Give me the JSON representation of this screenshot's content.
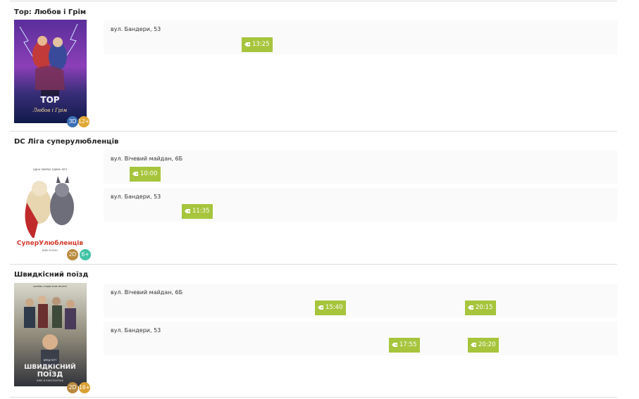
{
  "movies": [
    {
      "title": "Тор: Любов і Грім",
      "badges": [
        "3D",
        "12+"
      ],
      "venues": [
        {
          "address": "вул. Бандери, 53",
          "times": [
            "13:25"
          ]
        }
      ]
    },
    {
      "title": "DC Ліга суперулюбленців",
      "badges": [
        "2D",
        "6+"
      ],
      "poster_text": {
        "tagline": "ОДНА ЗБИРАЄ ЄДИНУ ЛІГУ",
        "logo": "СуперУлюбленців",
        "bottom": "ВЖЕ В КІНО"
      },
      "venues": [
        {
          "address": "вул. Вічевий майдан, 6Б",
          "times": [
            "10:00"
          ]
        },
        {
          "address": "вул. Бандери, 53",
          "times": [
            "11:35"
          ]
        }
      ]
    },
    {
      "title": "Швидкісний поїзд",
      "badges": [
        "2D",
        "16+"
      ],
      "poster_text": {
        "top": "КИНЕМА СТУДІЯ ЗАТВ ЛЕОНТЕ",
        "actor": "БРЕД ПІТТ",
        "logo_line1": "ШВИДКІСНИЙ",
        "logo_line2": "ПОЇЗД",
        "bottom": "ВЖЕ В КІНОТЕАТРАХ"
      },
      "venues": [
        {
          "address": "вул. Вічевий майдан, 6Б",
          "times": [
            "15:40",
            "20:15"
          ]
        },
        {
          "address": "вул. Бандери, 53",
          "times": [
            "17:55",
            "20:20"
          ]
        }
      ]
    }
  ],
  "colors": {
    "showtime_bg": "#a6c53d",
    "badge_3d": "#3a6fb5",
    "badge_2d": "#b98a3e",
    "badge_12": "#e0a832",
    "badge_6": "#41c3a5",
    "badge_16": "#d9a032"
  },
  "icons": {
    "ticket": "tag-icon"
  }
}
